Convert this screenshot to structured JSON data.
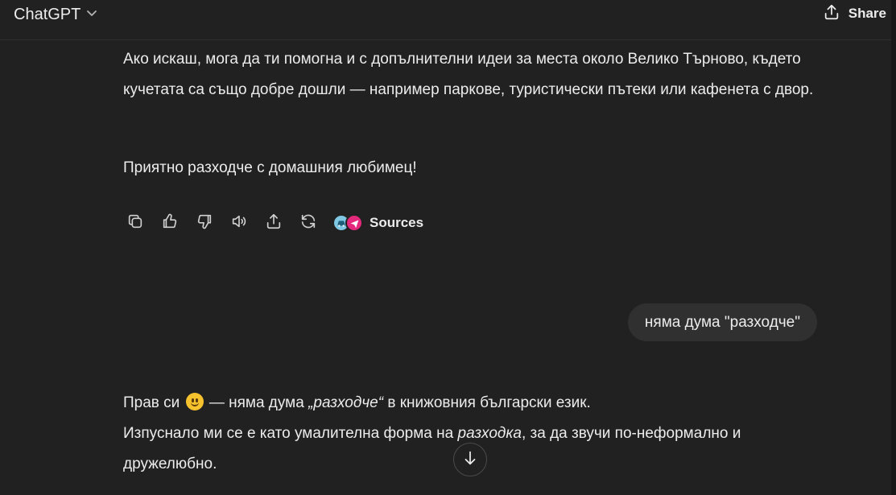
{
  "header": {
    "model_name": "ChatGPT",
    "share_label": "Share"
  },
  "assistant_message_1": {
    "para1": "Ако искаш, мога да ти помогна и с допълнителни идеи за места около Велико Търново, където кучетата са също добре дошли — например паркове, туристически пътеки или кафенета с двор.",
    "para2": "Приятно разходче с домашния любимец!"
  },
  "actions": {
    "icons": [
      "copy-icon",
      "thumbs-up-icon",
      "thumbs-down-icon",
      "read-aloud-icon",
      "share-icon",
      "regenerate-icon"
    ],
    "sources_label": "Sources"
  },
  "user_message": {
    "text": "няма дума \"разходче\""
  },
  "assistant_message_2": {
    "line1_a": "Прав си",
    "line1_b": " — няма дума ",
    "line1_em": "„разходче“",
    "line1_c": " в книжовния български език.",
    "line2_a": "Изпуснало ми се е като умалителна форма на ",
    "line2_em": "разходка",
    "line2_b": ", за да звучи по-неформално и дружелюбно."
  },
  "colors": {
    "background": "#212121",
    "bubble": "#303030",
    "text": "#ececec"
  }
}
